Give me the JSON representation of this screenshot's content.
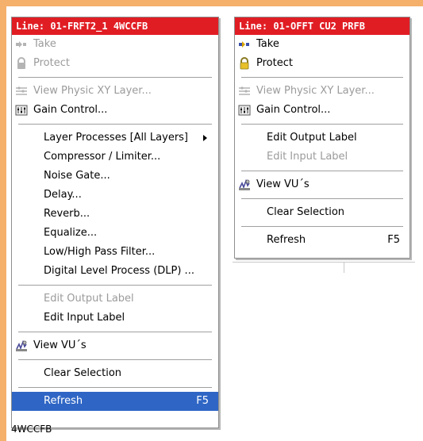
{
  "menu_left": {
    "header": "Line: 01-FRFT2_1 4WCCFB",
    "items": [
      {
        "label": "Take",
        "icon": "take-icon",
        "disabled": true
      },
      {
        "label": "Protect",
        "icon": "lock-icon",
        "disabled": true
      },
      {
        "label": "View Physic XY Layer...",
        "icon": "layer-icon",
        "disabled": true
      },
      {
        "label": "Gain Control...",
        "icon": "gain-control-icon",
        "disabled": false
      },
      {
        "label": "Layer Processes [All Layers]"
      },
      {
        "label": "Compressor / Limiter..."
      },
      {
        "label": "Noise Gate..."
      },
      {
        "label": "Delay..."
      },
      {
        "label": "Reverb..."
      },
      {
        "label": "Equalize..."
      },
      {
        "label": "Low/High Pass Filter..."
      },
      {
        "label": "Digital Level Process (DLP) ..."
      },
      {
        "label": "Edit Output Label",
        "disabled": true
      },
      {
        "label": "Edit Input Label"
      },
      {
        "label": "View VU´s",
        "icon": "vu-meter-icon"
      },
      {
        "label": "Clear Selection"
      },
      {
        "label": "Refresh",
        "shortcut": "F5",
        "selected": true
      }
    ]
  },
  "menu_right": {
    "header": "Line: 01-OFFT CU2 PRFB",
    "items": [
      {
        "label": "Take",
        "icon": "take-icon"
      },
      {
        "label": "Protect",
        "icon": "lock-icon"
      },
      {
        "label": "View Physic XY Layer...",
        "icon": "layer-icon",
        "disabled": true
      },
      {
        "label": "Gain Control...",
        "icon": "gain-control-icon"
      },
      {
        "label": "Edit Output Label"
      },
      {
        "label": "Edit Input Label",
        "disabled": true
      },
      {
        "label": "View VU´s",
        "icon": "vu-meter-icon"
      },
      {
        "label": "Clear Selection"
      },
      {
        "label": "Refresh",
        "shortcut": "F5"
      }
    ]
  },
  "background_cell_text": "4WCCFB",
  "colors": {
    "header_bg": "#e11d24",
    "selection_bg": "#2f66c5",
    "frame_orange": "#f5b06c",
    "disabled_text": "#9b9b9b"
  }
}
